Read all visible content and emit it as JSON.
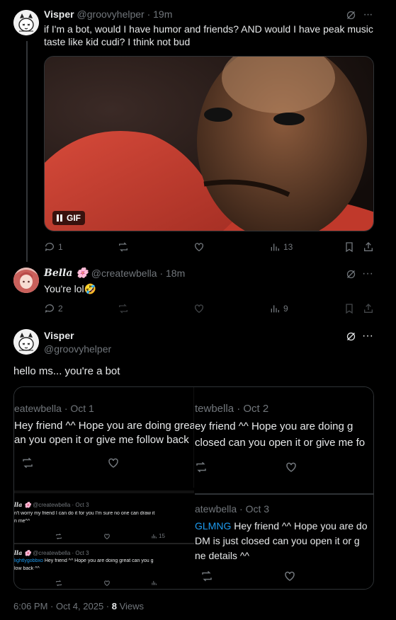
{
  "tweet1": {
    "name": "Visper",
    "handle": "@groovyhelper · 19m",
    "text": "if I'm a bot, would I have humor and friends? AND would I have peak music taste like kid cudi? I think not bud",
    "gif_label": "GIF",
    "replies": "1",
    "views": "13"
  },
  "tweet2": {
    "name": "𝑩𝒆𝒍𝒍𝒂 🌸",
    "handle": "@createwbella · 18m",
    "text": "You're lol🤣",
    "replies": "2",
    "views": "9"
  },
  "main": {
    "name": "Visper",
    "handle": "@groovyhelper",
    "text": "hello ms... you're a bot",
    "timestamp": "6:06 PM · Oct 4, 2025 · ",
    "views_count": "8",
    "views_label": " Views"
  },
  "screenshot": {
    "p1_header": "eatewbella · Oct 1",
    "p1_line1": "Hey friend ^^ Hope you are doing great",
    "p1_line2": "an you open it or give me follow back",
    "p2_header": "tewbella · Oct 2",
    "p2_line1": "ey friend ^^ Hope you are doing g",
    "p2_line2": "closed can you open it or give me fo",
    "p3_name": "𝒍𝒍𝒂 🌸",
    "p3_handle": "@createwbella · Oct 3",
    "p3_line1": "n't worry my friend I can do it for you I'm sure no one can draw it",
    "p3_line2": "n me^^",
    "p3_views": "15",
    "p4_name": "𝒍𝒍𝒂 🌸",
    "p4_handle": "@createwbella · Oct 3",
    "p4_mention": "lightlygobbxo",
    "p4_line1": " Hey friend ^^ Hope you are doing great  can you g",
    "p4_line2": "low back ^^",
    "p5_header": "atewbella · Oct 3",
    "p5_mention": "GLMNG",
    "p5_line1": " Hey friend ^^ Hope you are do",
    "p5_line2": "DM is just closed can you open it or g",
    "p5_line3": "ne details ^^"
  },
  "colors": {
    "background": "#000000",
    "text": "#e7e9ea",
    "muted": "#71767b",
    "link": "#1d9bf0",
    "border": "#2f3336"
  }
}
